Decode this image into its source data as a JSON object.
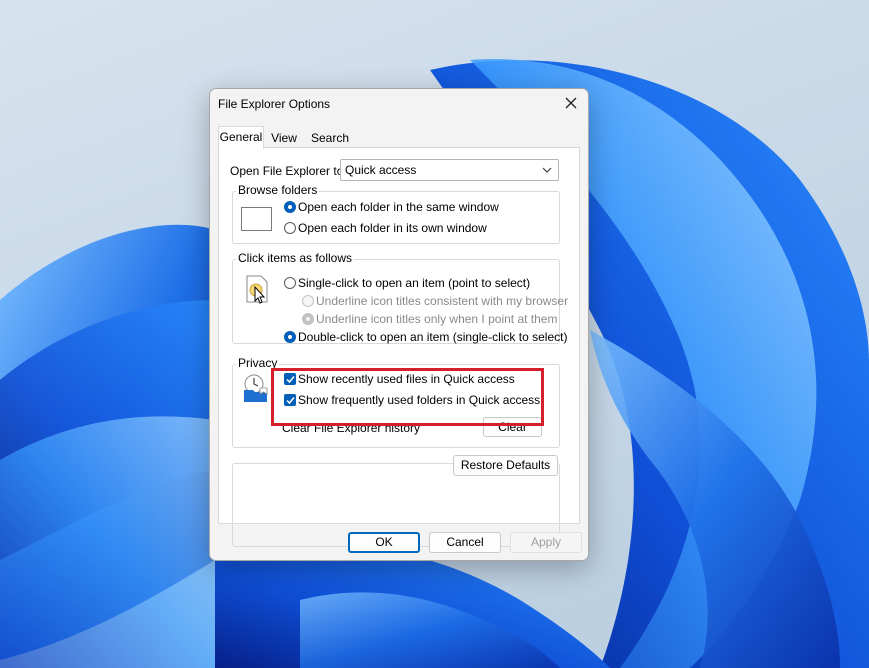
{
  "window": {
    "title": "File Explorer Options"
  },
  "tabs": [
    {
      "label": "General",
      "active": true
    },
    {
      "label": "View",
      "active": false
    },
    {
      "label": "Search",
      "active": false
    }
  ],
  "general": {
    "open_to_label": "Open File Explorer to:",
    "open_to_value": "Quick access",
    "browse_folders": {
      "label": "Browse folders",
      "options": [
        {
          "label": "Open each folder in the same window",
          "checked": true
        },
        {
          "label": "Open each folder in its own window",
          "checked": false
        }
      ]
    },
    "click_items": {
      "label": "Click items as follows",
      "single_click": "Single-click to open an item (point to select)",
      "underline_browser": "Underline icon titles consistent with my browser",
      "underline_point": "Underline icon titles only when I point at them",
      "double_click": "Double-click to open an item (single-click to select)"
    },
    "privacy": {
      "label": "Privacy",
      "show_recent_files": "Show recently used files in Quick access",
      "show_frequent_folders": "Show frequently used folders in Quick access",
      "clear_history_label": "Clear File Explorer history",
      "clear_button": "Clear"
    },
    "restore_defaults": "Restore Defaults"
  },
  "footer": {
    "ok": "OK",
    "cancel": "Cancel",
    "apply": "Apply"
  },
  "colors": {
    "accent": "#005fb8",
    "highlight": "#d3202a"
  }
}
